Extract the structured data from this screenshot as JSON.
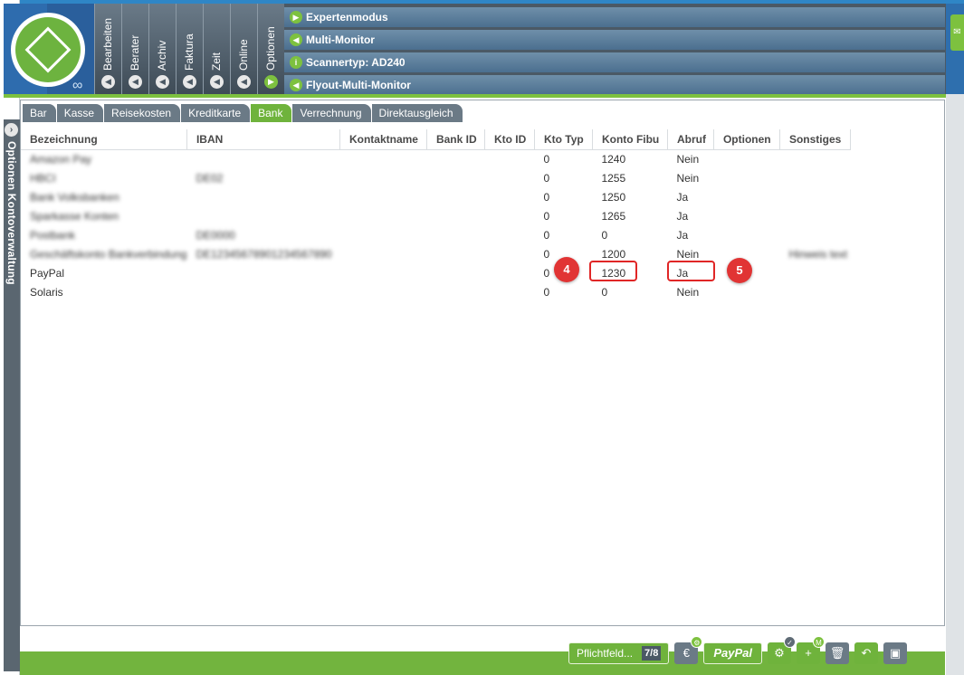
{
  "ribbon": {
    "tabs": [
      "Bearbeiten",
      "Berater",
      "Archiv",
      "Faktura",
      "Zeit",
      "Online",
      "Optionen"
    ],
    "menu": [
      "Expertenmodus",
      "Multi-Monitor",
      "Scannertyp: AD240",
      "Flyout-Multi-Monitor"
    ]
  },
  "side_panel": {
    "label": "Optionen  Kontoverwaltung"
  },
  "subtabs": [
    "Bar",
    "Kasse",
    "Reisekosten",
    "Kreditkarte",
    "Bank",
    "Verrechnung",
    "Direktausgleich"
  ],
  "active_subtab": "Bank",
  "table": {
    "columns": [
      "Bezeichnung",
      "IBAN",
      "Kontaktname",
      "Bank ID",
      "Kto ID",
      "Kto Typ",
      "Konto Fibu",
      "Abruf",
      "Optionen",
      "Sonstiges"
    ],
    "rows": [
      [
        "Amazon Pay",
        "",
        "",
        "",
        "",
        "0",
        "1240",
        "Nein",
        "",
        ""
      ],
      [
        "HBCI",
        "DE02",
        "",
        "",
        "",
        "0",
        "1255",
        "Nein",
        "",
        ""
      ],
      [
        "Bank Volksbanken",
        "",
        "",
        "",
        "",
        "0",
        "1250",
        "Ja",
        "",
        ""
      ],
      [
        "Sparkasse Konten",
        "",
        "",
        "",
        "",
        "0",
        "1265",
        "Ja",
        "",
        ""
      ],
      [
        "Postbank",
        "DE0000",
        "",
        "",
        "",
        "0",
        "0",
        "Ja",
        "",
        ""
      ],
      [
        "Geschäftskonto Bankverbindung",
        "DE12345678901234567890",
        "",
        "",
        "",
        "0",
        "1200",
        "Nein",
        "",
        "Hinweis text"
      ],
      [
        "PayPal",
        "",
        "",
        "",
        "",
        "0",
        "1230",
        "Ja",
        "",
        ""
      ],
      [
        "Solaris",
        "",
        "",
        "",
        "",
        "0",
        "0",
        "Nein",
        "",
        ""
      ]
    ]
  },
  "annotations": [
    "4",
    "5"
  ],
  "footer": {
    "pflicht_label": "Pflichtfeld...",
    "pflicht_count": "7/8",
    "paypal_label": "PayPal"
  },
  "colors": {
    "accent_green": "#6fb33c",
    "header_slate": "#4b5965",
    "menu_blue": "#5a7d9c",
    "marker_red": "#e02626"
  }
}
